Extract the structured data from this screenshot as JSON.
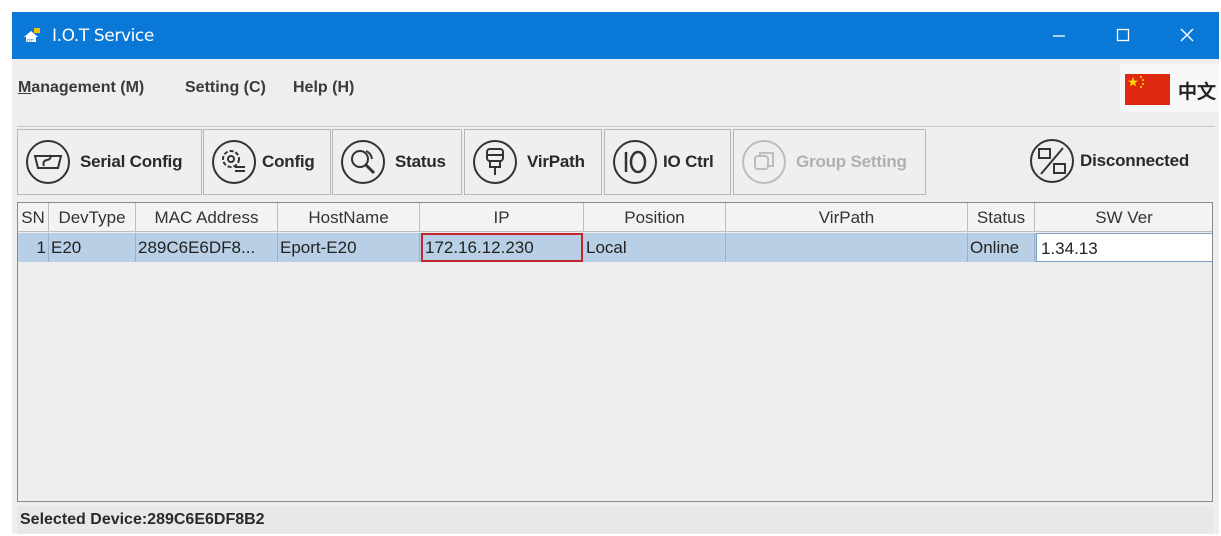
{
  "window": {
    "title": "I.O.T Service"
  },
  "menu": {
    "management_mnemonic": "M",
    "management_rest": "anagement (M)",
    "setting": "Setting (C)",
    "help": "Help (H)",
    "language": "中文"
  },
  "toolbar": {
    "serial_config": "Serial Config",
    "config": "Config",
    "status": "Status",
    "virpath": "VirPath",
    "io_ctrl": "IO Ctrl",
    "group_setting": "Group Setting",
    "connection": "Disconnected"
  },
  "table": {
    "headers": [
      "SN",
      "DevType",
      "MAC Address",
      "HostName",
      "IP",
      "Position",
      "VirPath",
      "Status",
      "SW Ver"
    ],
    "rows": [
      {
        "sn": "1",
        "devtype": "E20",
        "mac": "289C6E6DF8...",
        "hostname": "Eport-E20",
        "ip": "172.16.12.230",
        "position": "Local",
        "virpath": "",
        "status": "Online",
        "sw_ver": "1.34.13"
      }
    ]
  },
  "statusbar": {
    "text": "Selected Device:289C6E6DF8B2"
  },
  "colors": {
    "titlebar": "#0a78d7",
    "selected_row": "#b8cfe5",
    "selected_cell_border": "#c0282e"
  }
}
